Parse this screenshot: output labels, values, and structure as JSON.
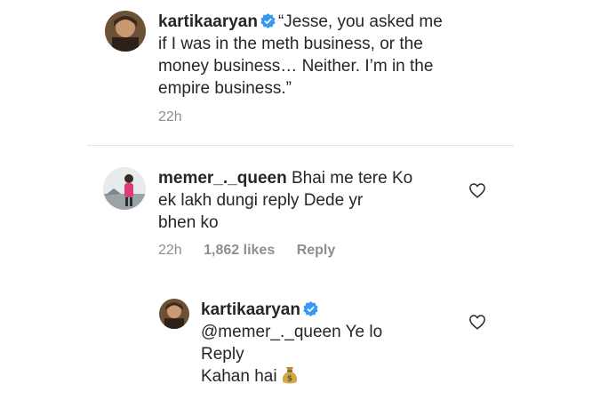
{
  "caption": {
    "username": "kartikaaryan",
    "text_lines": [
      "“Jesse, you asked me",
      "if I was in the meth business, or the",
      "money business… Neither. I’m in the",
      "empire business.”"
    ],
    "time": "22h"
  },
  "comment": {
    "username": "memer_._queen",
    "text_lines": [
      "Bhai me tere Ko",
      "ek lakh dungi reply Dede yr",
      "bhen ko"
    ],
    "time": "22h",
    "likes": "1,862 likes",
    "reply_label": "Reply"
  },
  "reply": {
    "username": "kartikaaryan",
    "mention": "@memer_._queen",
    "text_after_mention": "Ye lo",
    "lines": [
      "Reply",
      "Kahan hai"
    ],
    "emoji": "money-bag-icon"
  },
  "colors": {
    "text": "#262626",
    "muted": "#8e8e8e",
    "verified": "#3897f0",
    "divider": "#e3e3e3"
  }
}
